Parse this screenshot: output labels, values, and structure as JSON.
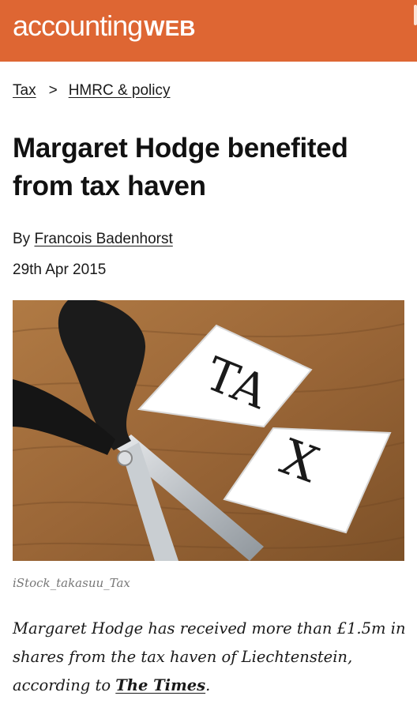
{
  "header": {
    "logo_word1": "accounting",
    "logo_word2": "WEB",
    "brand_color": "#de6633"
  },
  "breadcrumb": {
    "items": [
      "Tax",
      "HMRC & policy"
    ],
    "separator": ">"
  },
  "article": {
    "title": "Margaret Hodge benefited from tax haven",
    "by_prefix": "By",
    "author": "Francois Badenhorst",
    "date": "29th Apr 2015",
    "image_text_top": "TA",
    "image_text_bottom": "X",
    "image_caption": "iStock_takasuu_Tax",
    "standfirst_text": "Margaret Hodge has received more than £1.5m in shares from the tax haven of Liechtenstein, according to",
    "standfirst_link": "The Times",
    "standfirst_end": "."
  }
}
